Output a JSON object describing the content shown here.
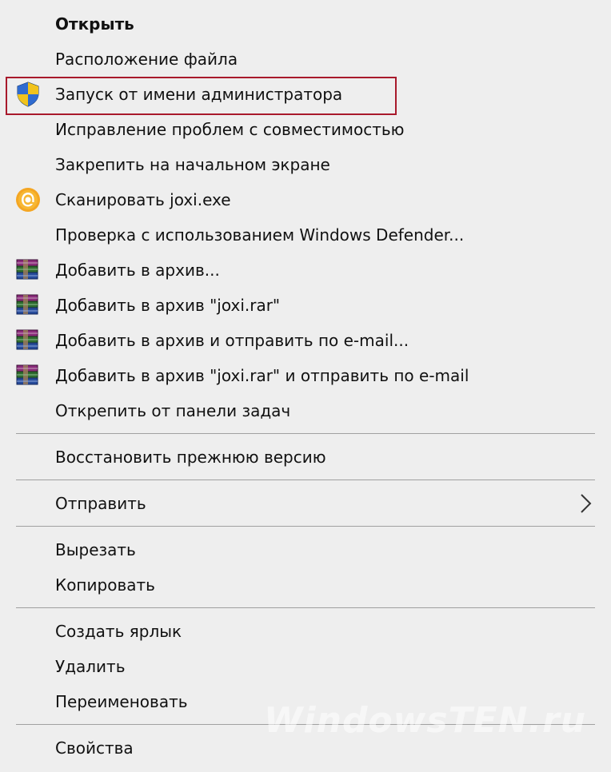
{
  "menu": {
    "items": [
      {
        "label": "Открыть",
        "icon": null
      },
      {
        "label": "Расположение файла",
        "icon": null
      },
      {
        "label": "Запуск от имени администратора",
        "icon": "uac-shield-icon"
      },
      {
        "label": "Исправление проблем с совместимостью",
        "icon": null
      },
      {
        "label": "Закрепить на начальном экране",
        "icon": null
      },
      {
        "label": "Сканировать joxi.exe",
        "icon": "avast-icon"
      },
      {
        "label": "Проверка с использованием Windows Defender...",
        "icon": null
      },
      {
        "label": "Добавить в архив...",
        "icon": "winrar-icon"
      },
      {
        "label": "Добавить в архив \"joxi.rar\"",
        "icon": "winrar-icon"
      },
      {
        "label": "Добавить в архив и отправить по e-mail...",
        "icon": "winrar-icon"
      },
      {
        "label": "Добавить в архив \"joxi.rar\" и отправить по e-mail",
        "icon": "winrar-icon"
      },
      {
        "label": "Открепить от панели задач",
        "icon": null
      },
      {
        "label": "Восстановить прежнюю версию",
        "icon": null
      },
      {
        "label": "Отправить",
        "icon": "chevron-right-icon"
      },
      {
        "label": "Вырезать",
        "icon": null
      },
      {
        "label": "Копировать",
        "icon": null
      },
      {
        "label": "Создать ярлык",
        "icon": null
      },
      {
        "label": "Удалить",
        "icon": null
      },
      {
        "label": "Переименовать",
        "icon": null
      },
      {
        "label": "Свойства",
        "icon": null
      }
    ]
  },
  "highlight_color": "#a8192b",
  "watermark": "WindowsTEN.ru"
}
